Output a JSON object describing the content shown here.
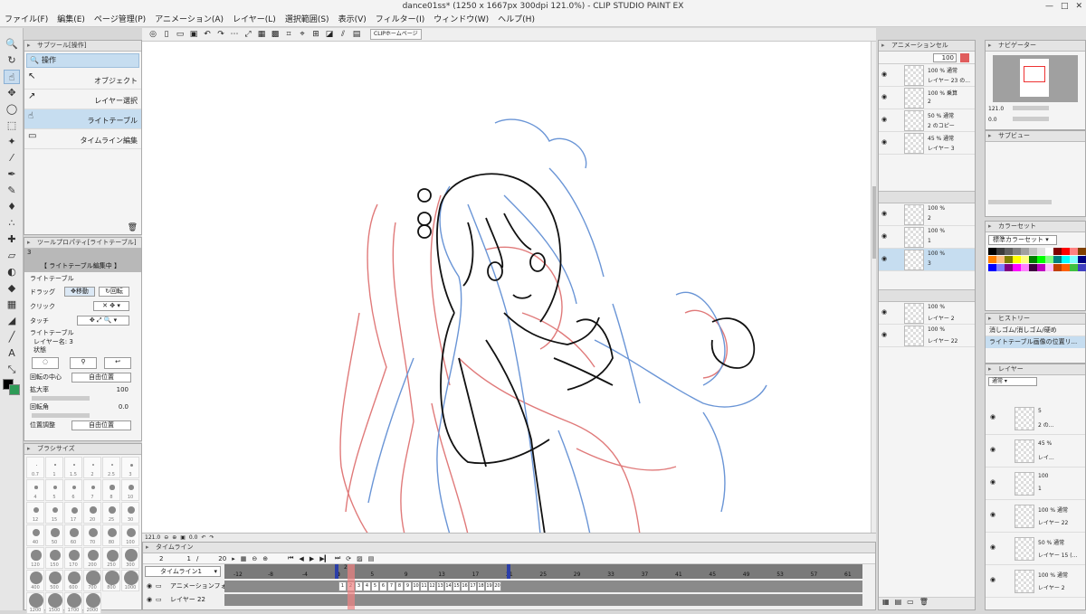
{
  "window": {
    "title": "dance01ss* (1250 x 1667px 300dpi 121.0%)  - CLIP STUDIO PAINT EX",
    "controls": [
      "—",
      "□",
      "✕"
    ]
  },
  "menu": [
    "ファイル(F)",
    "編集(E)",
    "ページ管理(P)",
    "アニメーション(A)",
    "レイヤー(L)",
    "選択範囲(S)",
    "表示(V)",
    "フィルター(I)",
    "ウィンドウ(W)",
    "ヘルプ(H)"
  ],
  "command_bar": {
    "home": "CLIPホームページ"
  },
  "subtool": {
    "header": "サブツール[操作]",
    "group": "操作",
    "items": [
      "オブジェクト",
      "レイヤー選択",
      "ライトテーブル",
      "タイムライン編集"
    ],
    "selected_index": 2
  },
  "tool_property": {
    "header": "ツールプロパティ[ライトテーブル]",
    "number": "3",
    "banner": "【 ライトテーブル編集中 】",
    "section": "ライトテーブル",
    "drag_label": "ドラッグ",
    "drag_move": "移動",
    "drag_rotate": "回転",
    "click_label": "クリック",
    "touch_label": "タッチ",
    "layer_section": "ライトテーブル",
    "layer_name": "レイヤー名: 3",
    "state": "状態",
    "center_label": "回転の中心",
    "center_value": "自由位置",
    "scale_label": "拡大率",
    "scale_value": "100",
    "angle_label": "回転角",
    "angle_value": "0.0",
    "pos_label": "位置調整",
    "pos_value": "自由位置"
  },
  "brush_size": {
    "header": "ブラシサイズ",
    "sizes": [
      "0.7",
      "1",
      "1.5",
      "2",
      "2.5",
      "3",
      "4",
      "5",
      "6",
      "7",
      "8",
      "10",
      "12",
      "15",
      "17",
      "20",
      "25",
      "30",
      "40",
      "50",
      "60",
      "70",
      "80",
      "100",
      "120",
      "150",
      "170",
      "200",
      "250",
      "300",
      "400",
      "500",
      "600",
      "700",
      "800",
      "1000",
      "1200",
      "1500",
      "1700",
      "2000"
    ]
  },
  "canvas": {
    "zoom": "121.0",
    "angle": "0.0"
  },
  "timeline": {
    "header": "タイムライン",
    "frame_current": "2",
    "frame_start": "1",
    "frame_sep": "/",
    "frame_end": "20",
    "selector": "タイムライン1",
    "ruler_neg": [
      "-12",
      "-8",
      "-4",
      "0"
    ],
    "ruler_pos": [
      "1",
      "5",
      "9",
      "13",
      "17",
      "21",
      "25",
      "29",
      "33",
      "37",
      "41",
      "45",
      "49",
      "53",
      "57",
      "61"
    ],
    "ruler_top": [
      "2"
    ],
    "tracks": [
      {
        "name": "アニメーションフォル"
      },
      {
        "name": "レイヤー 22"
      }
    ],
    "cells": [
      "1",
      "2",
      "3",
      "4",
      "5",
      "6",
      "7",
      "8",
      "9",
      "10",
      "11",
      "12",
      "13",
      "14",
      "15",
      "16",
      "17",
      "18",
      "19",
      "20"
    ]
  },
  "anim_cels": {
    "header": "アニメーションセル",
    "opacity": "100",
    "group1": [
      {
        "line1": "100 % 通常",
        "line2": "レイヤー 23 の..."
      },
      {
        "line1": "100 % 乗算",
        "line2": "2"
      },
      {
        "line1": "50 % 通常",
        "line2": "2 のコピー"
      },
      {
        "line1": "45 % 通常",
        "line2": "レイヤー 3"
      }
    ],
    "group2": [
      {
        "line1": "100 %",
        "line2": "2"
      },
      {
        "line1": "100 %",
        "line2": "1"
      },
      {
        "line1": "100 %",
        "line2": "3"
      }
    ],
    "group3": [
      {
        "line1": "100 %",
        "line2": "レイヤー 2"
      },
      {
        "line1": "100 %",
        "line2": "レイヤー 22"
      }
    ]
  },
  "navigator": {
    "header": "ナビゲーター",
    "tab2": "サブビュー",
    "zoom": "121.0",
    "angle": "0.0"
  },
  "color_set": {
    "header": "カラーセット",
    "selector": "標準カラーセット",
    "palette": [
      "#000000",
      "#3b3b3b",
      "#5e5e5e",
      "#7f7f7f",
      "#a0a0a0",
      "#c2c2c2",
      "#e0e0e0",
      "#ffffff",
      "#800000",
      "#ff0000",
      "#ff8080",
      "#804000",
      "#ff8000",
      "#ffc080",
      "#808000",
      "#ffff00",
      "#ffff80",
      "#008000",
      "#00ff00",
      "#80ff80",
      "#008080",
      "#00ffff",
      "#80ffff",
      "#000080",
      "#0000ff",
      "#8080ff",
      "#800080",
      "#ff00ff",
      "#ff80ff",
      "#400040",
      "#c000c0",
      "#ffc0ff",
      "#c04000",
      "#ff6000",
      "#40c040",
      "#4040c0"
    ]
  },
  "history": {
    "header": "ヒストリー",
    "items": [
      "消しゴム/消しゴム/硬め",
      "ライトテーブル画像の位置リ..."
    ]
  },
  "layer_panel": {
    "header": "レイヤー",
    "blend": "通常",
    "rows": [
      {
        "line1": "5",
        "line2": "2 の..."
      },
      {
        "line1": "45 %",
        "line2": "レイ..."
      },
      {
        "line1": "100",
        "line2": "1"
      },
      {
        "line1": "100 % 通常",
        "line2": "レイヤー 22"
      },
      {
        "line1": "50 % 通常",
        "line2": "レイヤー 15 (..."
      },
      {
        "line1": "100 % 通常",
        "line2": "レイヤー 2"
      }
    ]
  },
  "colors": {
    "accent": "#c6ddf0",
    "main_color": "#000000",
    "sub_color": "#2e9b57",
    "prev_onion": "#e07a7a",
    "next_onion": "#6a95d6"
  }
}
